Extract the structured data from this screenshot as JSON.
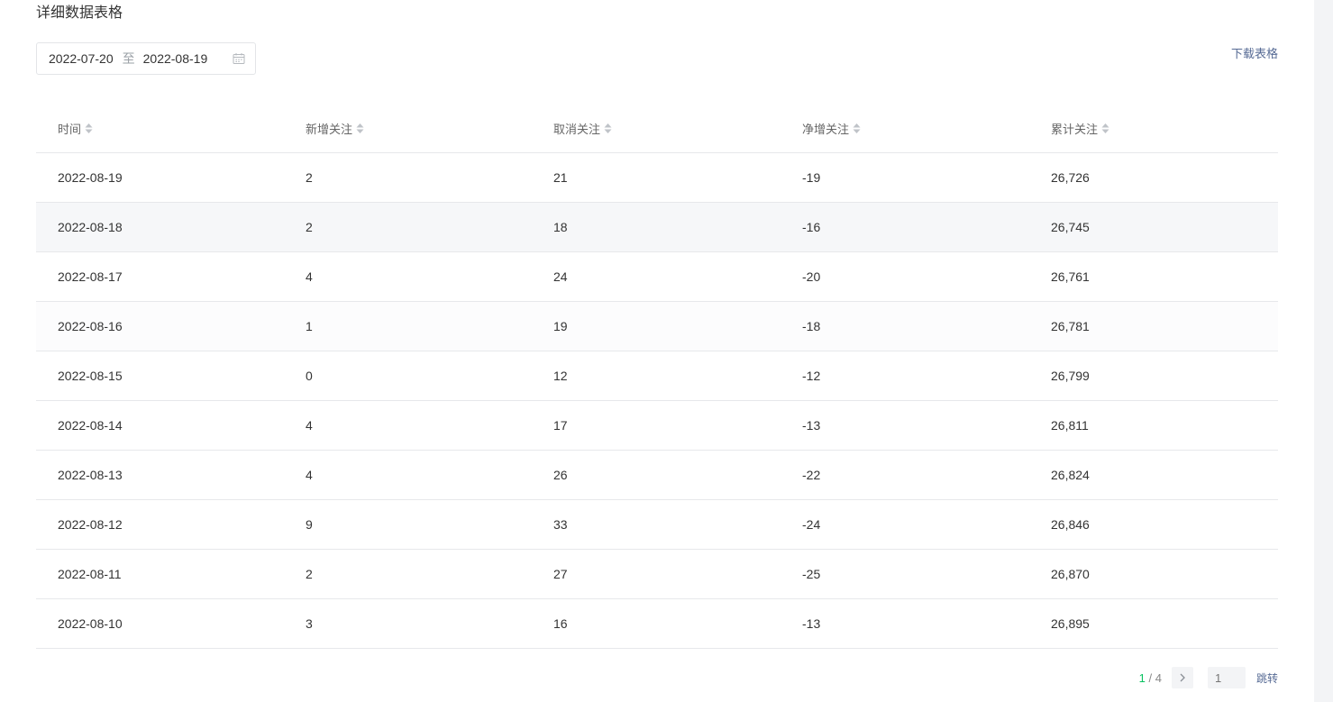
{
  "section": {
    "title": "详细数据表格"
  },
  "date_range": {
    "start": "2022-07-20",
    "separator": "至",
    "end": "2022-08-19"
  },
  "actions": {
    "download_label": "下载表格"
  },
  "table": {
    "headers": [
      "时间",
      "新增关注",
      "取消关注",
      "净增关注",
      "累计关注"
    ],
    "rows": [
      [
        "2022-08-19",
        "2",
        "21",
        "-19",
        "26,726"
      ],
      [
        "2022-08-18",
        "2",
        "18",
        "-16",
        "26,745"
      ],
      [
        "2022-08-17",
        "4",
        "24",
        "-20",
        "26,761"
      ],
      [
        "2022-08-16",
        "1",
        "19",
        "-18",
        "26,781"
      ],
      [
        "2022-08-15",
        "0",
        "12",
        "-12",
        "26,799"
      ],
      [
        "2022-08-14",
        "4",
        "17",
        "-13",
        "26,811"
      ],
      [
        "2022-08-13",
        "4",
        "26",
        "-22",
        "26,824"
      ],
      [
        "2022-08-12",
        "9",
        "33",
        "-24",
        "26,846"
      ],
      [
        "2022-08-11",
        "2",
        "27",
        "-25",
        "26,870"
      ],
      [
        "2022-08-10",
        "3",
        "16",
        "-13",
        "26,895"
      ]
    ]
  },
  "pagination": {
    "current": "1",
    "separator": " / ",
    "total": "4",
    "input_placeholder": "1",
    "jump_label": "跳转"
  },
  "colors": {
    "accent_green": "#07c160",
    "link_blue": "#576b95"
  },
  "icons": {
    "calendar": "calendar-icon",
    "sort": "sort-icon",
    "next": "chevron-right-icon"
  }
}
